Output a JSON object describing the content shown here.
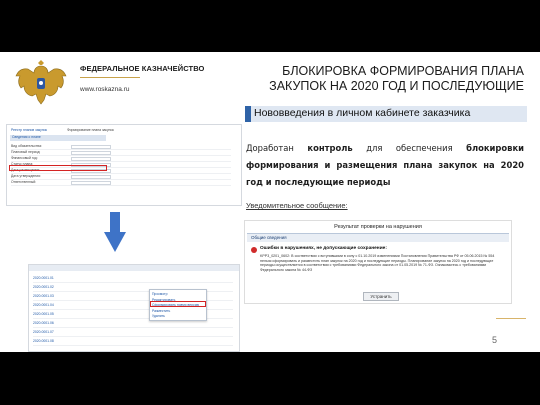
{
  "header": {
    "org_name": "ФЕДЕРАЛЬНОЕ КАЗНАЧЕЙСТВО",
    "site": "www.roskazna.ru",
    "title_line1": "БЛОКИРОВКА ФОРМИРОВАНИЯ ПЛАНА",
    "title_line2": "ЗАКУПОК НА 2020 ГОД И ПОСЛЕДУЮЩИЕ"
  },
  "tab": {
    "label": "Нововведения в личном кабинете заказчика"
  },
  "body": {
    "word1": "Доработан",
    "word2": "контроль",
    "rest1": "для обеспечения",
    "bold2": "блокировки формирования и размещения плана закупок на 2020 год и последующие периоды"
  },
  "notice": "Уведомительное сообщение:",
  "dialog": {
    "title": "Результат проверки на нарушения",
    "section": "Общие сведения",
    "error_head": "Ошибки в нарушениях, не допускающие сохранение:",
    "error_text": "KPP3_0201_0602: В соответствии с вступившими в силу с 01.10.2019 изменениями Постановления Правительства РФ от 05.06.2015 № 554 нельзя сформировать и разместить план закупок на 2020 год и последующие периоды. Планирование закупок на 2020 год и последующие периоды осуществляется в соответствии с требованиями Федерального закона от 01.05.2019 № 71-ФЗ. Ознакомьтесь с требованиями Федерального закона № 44-ФЗ",
    "ok_label": "Устранить"
  },
  "screenshot1": {
    "breadcrumb": "Реестр планов закупок",
    "crumb2": "Формирование плана закупок",
    "section": "Сведения о плане",
    "rows": [
      "Вид обязательства:",
      "Плановый период:",
      "Финансовый год:",
      "Статус плана:",
      "Дата размещения:",
      "Дата утверждения:",
      "Ответственный:"
    ],
    "highlighted": "Финансовый год"
  },
  "screenshot2": {
    "rows": [
      "2020.0001.01",
      "2020.0001.02",
      "2020.0001.03",
      "2020.0001.04",
      "2020.0001.05",
      "2020.0001.06",
      "2020.0001.07",
      "2020.0001.08"
    ],
    "menu": [
      "Просмотр",
      "Редактировать",
      "Сформировать новую версию",
      "Разместить",
      "Удалить"
    ]
  },
  "footer": {
    "page_number": "5"
  },
  "colors": {
    "accent": "#2f63a7",
    "gold": "#c8a24a",
    "error": "#d02b2b",
    "arrow": "#3e73c7"
  }
}
